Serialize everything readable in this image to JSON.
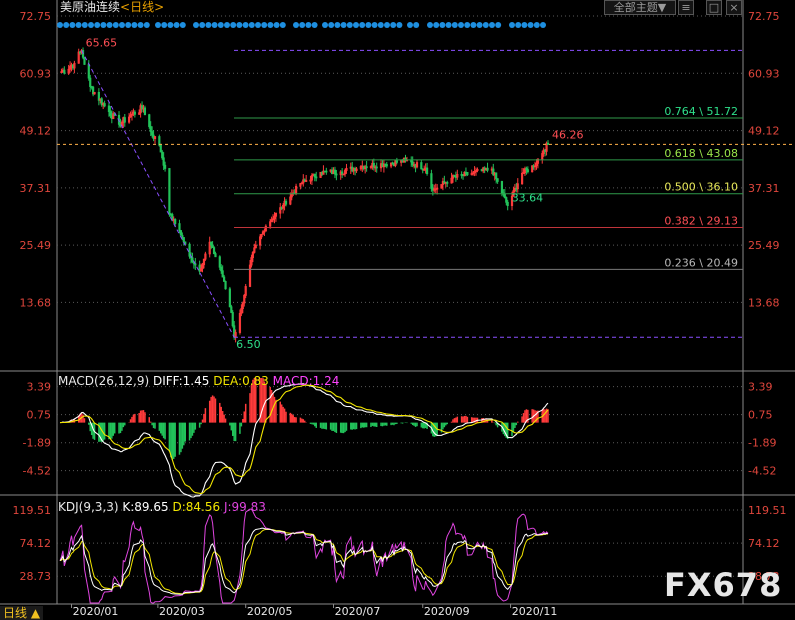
{
  "header": {
    "instrument": "美原油连续",
    "period": "<日线>",
    "template_label": "全部主题▼",
    "btn_restore": "□",
    "btn_close": "×"
  },
  "colors": {
    "up": "#ff3b3b",
    "down": "#22c25a",
    "price_axis": "#e0463c",
    "grid": "#5a5a5a",
    "diff": "#ffffff",
    "dea": "#f2e600",
    "macd_label": "#ff44ff",
    "k": "#ffffff",
    "d": "#f2e600",
    "j": "#e045e0",
    "fib_line": "#2f9a4a",
    "dots": "#1e8fe0"
  },
  "main_axis": {
    "ticks": [
      "72.75",
      "60.93",
      "49.12",
      "37.31",
      "25.49",
      "13.68"
    ]
  },
  "macd_axis": {
    "ticks": [
      "3.39",
      "0.75",
      "-1.89",
      "-4.52"
    ]
  },
  "kdj_axis": {
    "ticks": [
      "119.51",
      "74.12",
      "28.73"
    ]
  },
  "time_axis": {
    "labels": [
      "2020/01",
      "2020/03",
      "2020/05",
      "2020/07",
      "2020/09",
      "2020/11"
    ]
  },
  "period_button": "日线 ▲",
  "annotations": {
    "high": "65.65",
    "low": "6.50",
    "last": "46.26",
    "pivot": "33.64"
  },
  "fib": [
    {
      "label": "0.764 \\ 51.72",
      "value": 51.72,
      "color": "#2ee08a"
    },
    {
      "label": "0.618 \\ 43.08",
      "value": 43.08,
      "color": "#9be64a"
    },
    {
      "label": "0.500 \\ 36.10",
      "value": 36.1,
      "color": "#e8e85a"
    },
    {
      "label": "0.382 \\ 29.13",
      "value": 29.13,
      "color": "#ff4f55"
    },
    {
      "label": "0.236 \\ 20.49",
      "value": 20.49,
      "color": "#b8b8b8"
    }
  ],
  "macd_legend": {
    "name": "MACD(26,12,9)",
    "diff": "DIFF:1.45",
    "dea": "DEA:0.83",
    "macd": "MACD:1.24"
  },
  "kdj_legend": {
    "name": "KDJ(9,3,3)",
    "k": "K:89.65",
    "d": "D:84.56",
    "j": "J:99.83"
  },
  "watermark": "FX678",
  "chart_data": {
    "type": "candlestick",
    "price_range": [
      1.8,
      72.75
    ],
    "macd_range": [
      -7.0,
      4.2
    ],
    "kdj_range": [
      -8,
      125
    ],
    "close_series": [
      {
        "t": "2019-12-24",
        "close": 61.1
      },
      {
        "t": "2020-01-03",
        "close": 63.0
      },
      {
        "t": "2020-01-08",
        "close": 65.65
      },
      {
        "t": "2020-01-14",
        "close": 58.2
      },
      {
        "t": "2020-01-24",
        "close": 54.2
      },
      {
        "t": "2020-02-03",
        "close": 50.4
      },
      {
        "t": "2020-02-12",
        "close": 52.5
      },
      {
        "t": "2020-02-20",
        "close": 53.8
      },
      {
        "t": "2020-02-25",
        "close": 48.9
      },
      {
        "t": "2020-03-02",
        "close": 46.1
      },
      {
        "t": "2020-03-06",
        "close": 41.3
      },
      {
        "t": "2020-03-09",
        "close": 31.9
      },
      {
        "t": "2020-03-16",
        "close": 28.5
      },
      {
        "t": "2020-03-23",
        "close": 23.2
      },
      {
        "t": "2020-03-30",
        "close": 20.1
      },
      {
        "t": "2020-04-06",
        "close": 26.1
      },
      {
        "t": "2020-04-14",
        "close": 20.2
      },
      {
        "t": "2020-04-21",
        "close": 11.6
      },
      {
        "t": "2020-04-23",
        "close": 6.5
      },
      {
        "t": "2020-04-28",
        "close": 12.4
      },
      {
        "t": "2020-05-06",
        "close": 24.0
      },
      {
        "t": "2020-05-15",
        "close": 29.4
      },
      {
        "t": "2020-05-27",
        "close": 33.7
      },
      {
        "t": "2020-06-08",
        "close": 38.2
      },
      {
        "t": "2020-06-22",
        "close": 40.5
      },
      {
        "t": "2020-07-06",
        "close": 40.6
      },
      {
        "t": "2020-07-21",
        "close": 41.8
      },
      {
        "t": "2020-08-05",
        "close": 42.2
      },
      {
        "t": "2020-08-20",
        "close": 42.9
      },
      {
        "t": "2020-09-03",
        "close": 41.4
      },
      {
        "t": "2020-09-08",
        "close": 36.8
      },
      {
        "t": "2020-09-21",
        "close": 39.3
      },
      {
        "t": "2020-10-06",
        "close": 40.4
      },
      {
        "t": "2020-10-19",
        "close": 41.2
      },
      {
        "t": "2020-10-30",
        "close": 33.64
      },
      {
        "t": "2020-11-09",
        "close": 40.3
      },
      {
        "t": "2020-11-17",
        "close": 41.8
      },
      {
        "t": "2020-11-24",
        "close": 45.1
      },
      {
        "t": "2020-11-27",
        "close": 46.26
      }
    ]
  }
}
